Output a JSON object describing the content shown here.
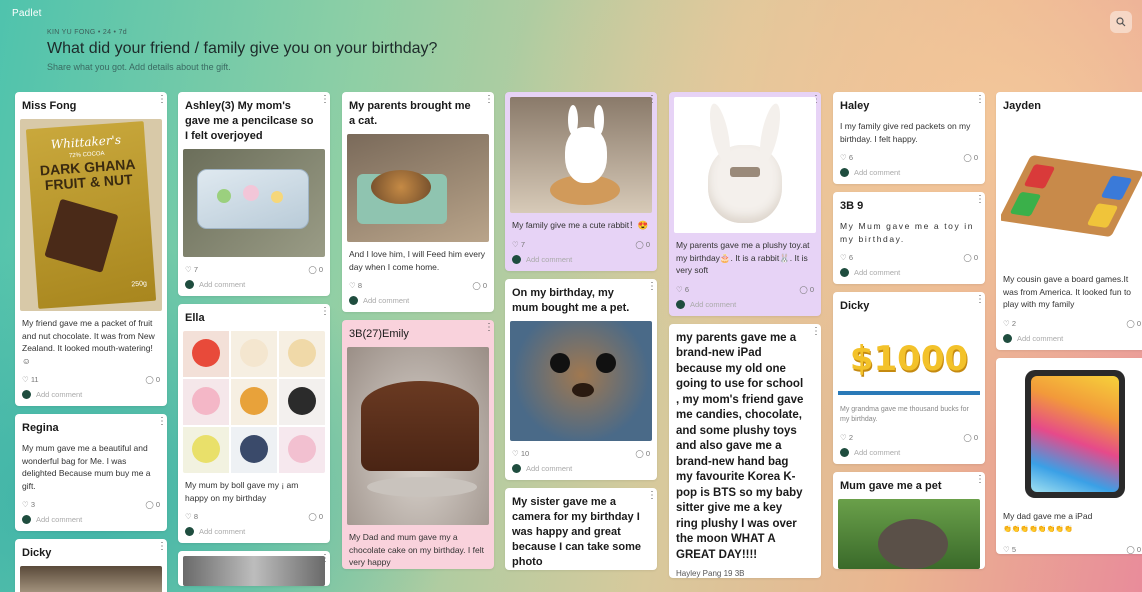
{
  "app": {
    "logo": "Padlet"
  },
  "header": {
    "meta": "KIN YU FONG • 24 • 7d",
    "title": "What did your friend / family give you on your birthday?",
    "subtitle": "Share what you got. Add details about the gift."
  },
  "add_comment": "Add comment",
  "cards": {
    "miss_fong": {
      "title": "Miss Fong",
      "body": "My friend gave me a packet of fruit and nut chocolate. It was from New Zealand. It looked mouth-watering! ☺",
      "likes": "11",
      "comments": "0",
      "wrapper": {
        "brand": "Whittaker's",
        "pct": "72% COCOA",
        "n1": "DARK GHANA",
        "n2": "FRUIT & NUT",
        "w": "250g"
      }
    },
    "regina": {
      "title": "Regina",
      "body": "My mum gave me a beautiful and wonderful bag for Me. I was delighted Because mum buy me a gift.",
      "likes": "3",
      "comments": "0"
    },
    "dicky1": {
      "title": "Dicky"
    },
    "ashley": {
      "title": "Ashley(3) My mom's  gave me a pencilcase so I felt overjoyed",
      "likes": "7",
      "comments": "0"
    },
    "ella": {
      "title": "Ella",
      "body": "My mum by boll gave my ¡ am happy on my birthday",
      "likes": "8",
      "comments": "0"
    },
    "parents_cat": {
      "title": "My parents brought me a cat.",
      "body": "And I love him, I will Feed him every  day when I come home.",
      "likes": "8",
      "comments": "0"
    },
    "emily": {
      "title": "3B(27)Emily",
      "body": "My Dad and mum gave my a chocolate cake on my birthday. I felt very happy"
    },
    "rabbit": {
      "body": "My family give me a cute rabbit！😍",
      "likes": "7",
      "comments": "0"
    },
    "pet": {
      "title": "On my birthday, my mum bought me a pet.",
      "likes": "10",
      "comments": "0"
    },
    "camera": {
      "title": "My sister gave me a camera for my birthday I was happy and great because I can take some photo"
    },
    "plushy": {
      "body": "My parents gave me a plushy toy.at my birthday🎂. It is a rabbit🐰. It is very soft",
      "likes": "6",
      "comments": "0"
    },
    "ipad_long": {
      "title": " my parents gave me a brand-new iPad because my old one  going to use for school ,  my mom's friend gave me candies, chocolate, and some plushy toys and also gave me a brand-new hand bag my favourite Korea K-pop is BTS so my baby sitter  give me a key ring plushy I was over the moon WHAT A GREAT DAY!!!!",
      "sig": "Hayley Pang 19 3B"
    },
    "haley": {
      "title": "Haley",
      "body": "I my family give red packets on my birthday. I felt happy.",
      "likes": "6",
      "comments": "0"
    },
    "b3_9": {
      "title": "3B 9",
      "body": "My Mum gave me a toy in my birthday.",
      "likes": "6",
      "comments": "0"
    },
    "dicky2": {
      "title": "Dicky",
      "body": "My grandma gave me thousand bucks for my birthday.",
      "likes": "2",
      "comments": "0",
      "banner": "$1000"
    },
    "mum_pet": {
      "title": "Mum gave me a pet"
    },
    "jayden": {
      "title": "Jayden",
      "body": "My cousin gave a board games.It was from America. It looked fun to play with my family",
      "likes": "2",
      "comments": "0"
    },
    "dad_ipad": {
      "body": "My dad gave me a iPad",
      "emojis": "👏👏👏👏👏👏👏👏",
      "likes": "5",
      "comments": "0"
    }
  },
  "colors": {
    "avatar": "#1f4d3f"
  }
}
